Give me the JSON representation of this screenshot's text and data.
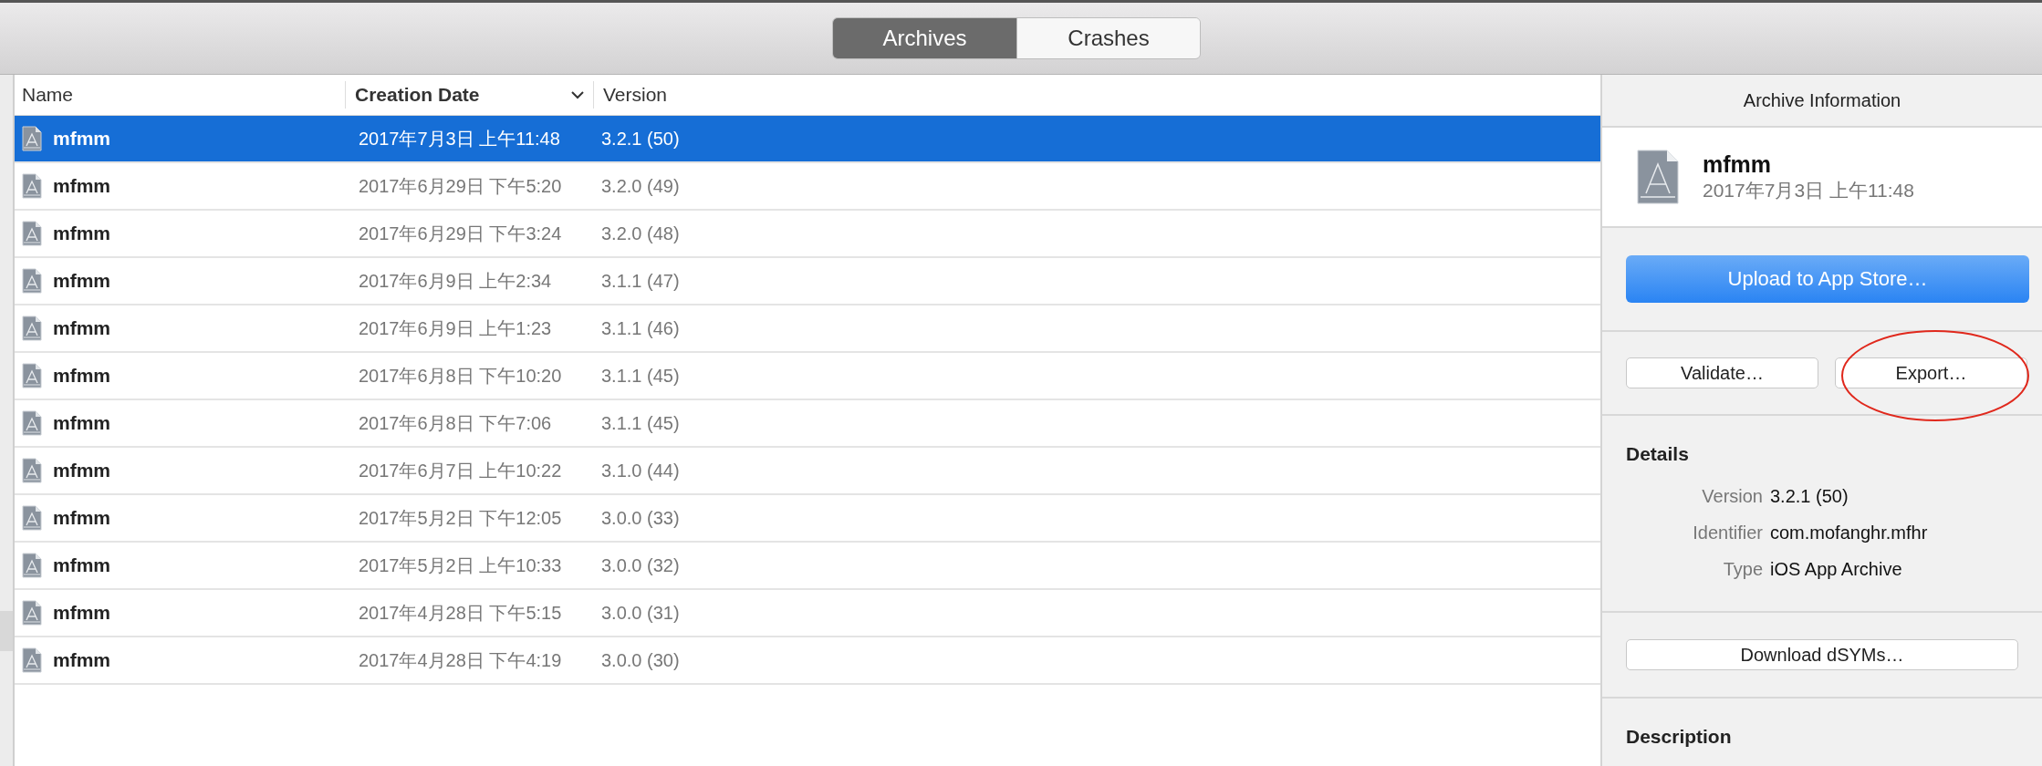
{
  "tabs": [
    {
      "label": "Archives",
      "selected": true
    },
    {
      "label": "Crashes",
      "selected": false
    }
  ],
  "table": {
    "columns": [
      {
        "label": "Name",
        "sorted": false
      },
      {
        "label": "Creation Date",
        "sorted": true
      },
      {
        "label": "Version",
        "sorted": false
      }
    ],
    "rows": [
      {
        "name": "mfmm",
        "date": "2017年7月3日 上午11:48",
        "version": "3.2.1 (50)",
        "selected": true
      },
      {
        "name": "mfmm",
        "date": "2017年6月29日 下午5:20",
        "version": "3.2.0 (49)",
        "selected": false
      },
      {
        "name": "mfmm",
        "date": "2017年6月29日 下午3:24",
        "version": "3.2.0 (48)",
        "selected": false
      },
      {
        "name": "mfmm",
        "date": "2017年6月9日 上午2:34",
        "version": "3.1.1 (47)",
        "selected": false
      },
      {
        "name": "mfmm",
        "date": "2017年6月9日 上午1:23",
        "version": "3.1.1 (46)",
        "selected": false
      },
      {
        "name": "mfmm",
        "date": "2017年6月8日 下午10:20",
        "version": "3.1.1 (45)",
        "selected": false
      },
      {
        "name": "mfmm",
        "date": "2017年6月8日 下午7:06",
        "version": "3.1.1 (45)",
        "selected": false
      },
      {
        "name": "mfmm",
        "date": "2017年6月7日 上午10:22",
        "version": "3.1.0 (44)",
        "selected": false
      },
      {
        "name": "mfmm",
        "date": "2017年5月2日 下午12:05",
        "version": "3.0.0 (33)",
        "selected": false
      },
      {
        "name": "mfmm",
        "date": "2017年5月2日 上午10:33",
        "version": "3.0.0 (32)",
        "selected": false
      },
      {
        "name": "mfmm",
        "date": "2017年4月28日 下午5:15",
        "version": "3.0.0 (31)",
        "selected": false
      },
      {
        "name": "mfmm",
        "date": "2017年4月28日 下午4:19",
        "version": "3.0.0 (30)",
        "selected": false
      }
    ]
  },
  "inspector": {
    "title": "Archive Information",
    "archive_name": "mfmm",
    "archive_date": "2017年7月3日 上午11:48",
    "upload_button": "Upload to App Store…",
    "validate_button": "Validate…",
    "export_button": "Export…",
    "details_heading": "Details",
    "details": [
      {
        "label": "Version",
        "value": "3.2.1 (50)"
      },
      {
        "label": "Identifier",
        "value": "com.mofanghr.mfhr"
      },
      {
        "label": "Type",
        "value": "iOS App Archive"
      }
    ],
    "dsyms_button": "Download dSYMs…",
    "description_heading": "Description"
  }
}
